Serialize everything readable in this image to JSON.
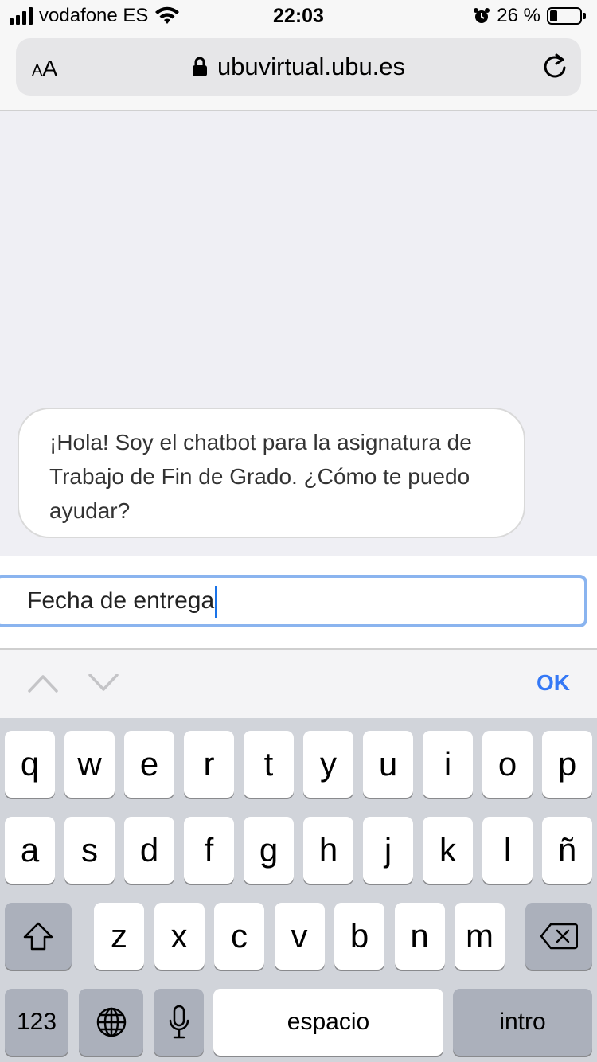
{
  "status_bar": {
    "carrier": "vodafone ES",
    "time": "22:03",
    "battery_percent": "26 %",
    "battery_level": 0.26
  },
  "browser": {
    "text_size_small": "A",
    "text_size_large": "A",
    "url": "ubuvirtual.ubu.es"
  },
  "chat": {
    "bot_message": "¡Hola! Soy el chatbot para la asignatura de Trabajo de Fin de Grado. ¿Cómo te puedo ayudar?",
    "input_value": "Fecha de entrega"
  },
  "accessory_bar": {
    "done_label": "OK"
  },
  "keyboard": {
    "row1": [
      "q",
      "w",
      "e",
      "r",
      "t",
      "y",
      "u",
      "i",
      "o",
      "p"
    ],
    "row2": [
      "a",
      "s",
      "d",
      "f",
      "g",
      "h",
      "j",
      "k",
      "l",
      "ñ"
    ],
    "row3": [
      "z",
      "x",
      "c",
      "v",
      "b",
      "n",
      "m"
    ],
    "numbers_label": "123",
    "space_label": "espacio",
    "return_label": "intro"
  }
}
